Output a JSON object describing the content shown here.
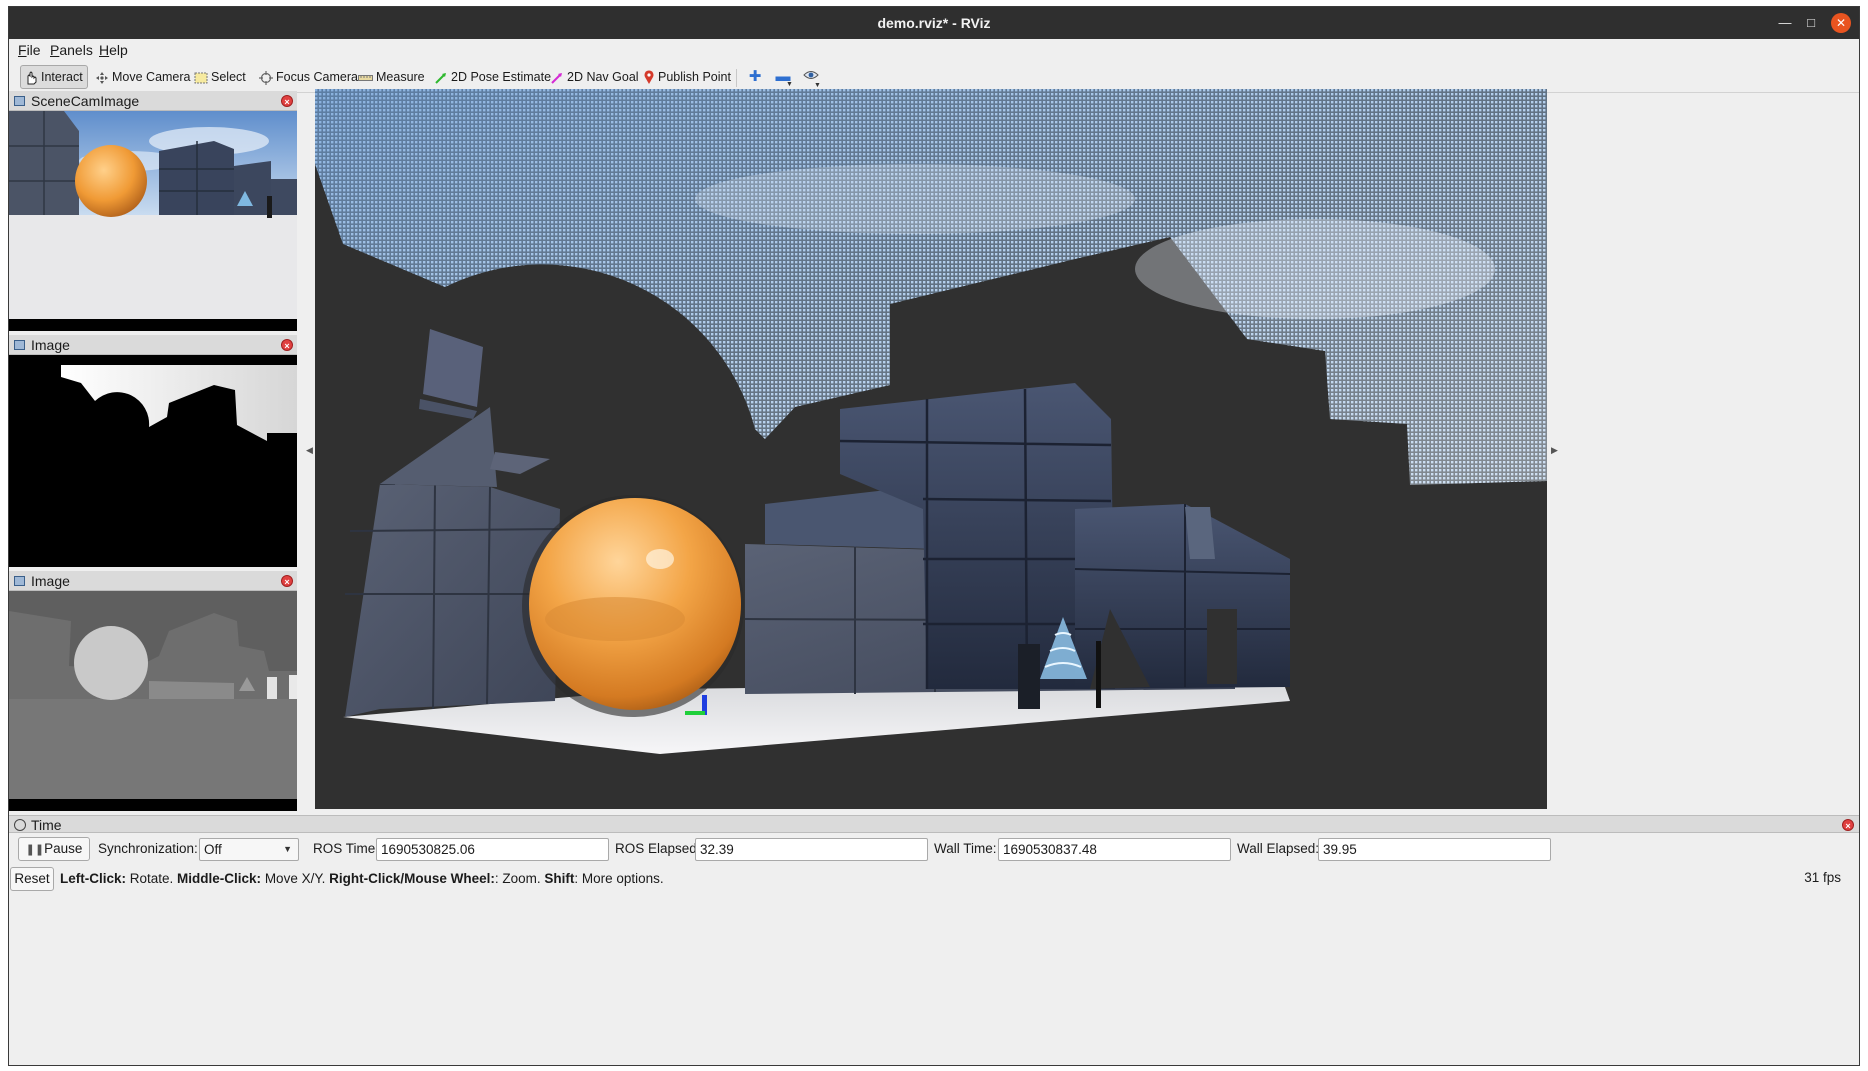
{
  "window": {
    "title": "demo.rviz* - RViz"
  },
  "menu": {
    "items": [
      "File",
      "Panels",
      "Help"
    ]
  },
  "toolbar": {
    "tools": [
      {
        "label": "Interact",
        "icon": "hand-icon",
        "active": true
      },
      {
        "label": "Move Camera",
        "icon": "move-camera-icon"
      },
      {
        "label": "Select",
        "icon": "select-icon"
      },
      {
        "label": "Focus Camera",
        "icon": "focus-camera-icon"
      },
      {
        "label": "Measure",
        "icon": "ruler-icon"
      },
      {
        "label": "2D Pose Estimate",
        "icon": "green-arrow-icon"
      },
      {
        "label": "2D Nav Goal",
        "icon": "magenta-arrow-icon"
      },
      {
        "label": "Publish Point",
        "icon": "map-pin-icon"
      }
    ],
    "extra_icons": [
      "plus-icon",
      "minus-icon",
      "eye-icon"
    ]
  },
  "panels": [
    {
      "title": "SceneCamImage"
    },
    {
      "title": "Image"
    },
    {
      "title": "Image"
    }
  ],
  "time": {
    "title": "Time",
    "pause_label": "Pause",
    "sync_label": "Synchronization:",
    "sync_value": "Off",
    "ros_time_label": "ROS Time:",
    "ros_time_value": "1690530825.06",
    "ros_elapsed_label": "ROS Elapsed:",
    "ros_elapsed_value": "32.39",
    "wall_time_label": "Wall Time:",
    "wall_time_value": "1690530837.48",
    "wall_elapsed_label": "Wall Elapsed:",
    "wall_elapsed_value": "39.95"
  },
  "status": {
    "reset_label": "Reset",
    "left_click": "Left-Click:",
    "left_click_desc": " Rotate. ",
    "middle_click": "Middle-Click:",
    "middle_click_desc": " Move X/Y. ",
    "right_click": "Right-Click/Mouse Wheel:",
    "right_click_desc": ": Zoom. ",
    "shift": "Shift",
    "shift_desc": ": More options.",
    "fps": "31 fps"
  },
  "colors": {
    "titlebar": "#2f2f2f",
    "close_button": "#e95420",
    "viewport_bg": "#303030",
    "sphere": "#f0a040",
    "boxes": "#3b4860",
    "sky": "#8fb4de"
  }
}
